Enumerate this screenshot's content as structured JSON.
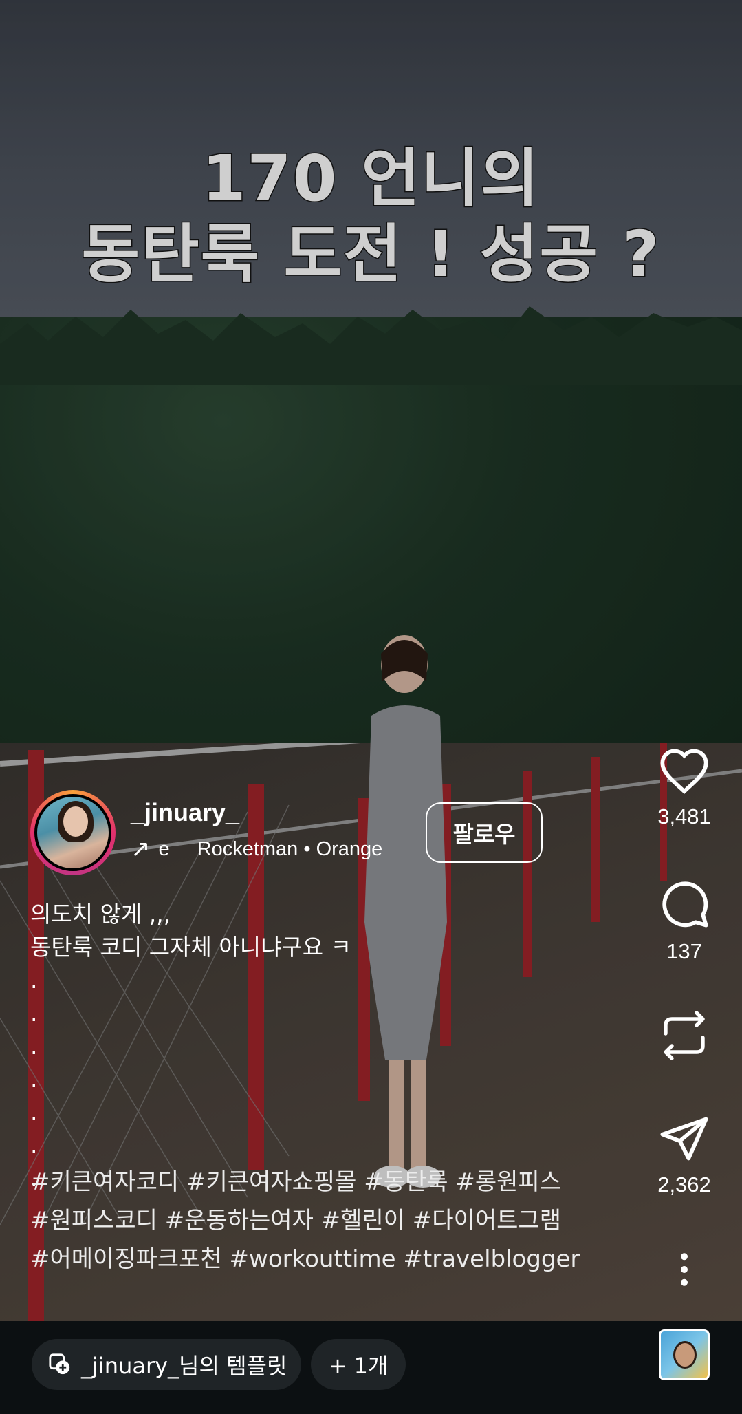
{
  "headline": {
    "line1": "170 언니의",
    "line2": "동탄룩 도전 ! 성공 ?"
  },
  "author": {
    "username": "_jinuary_",
    "music_prefix": "e",
    "music_track": "Rocketman • Orange",
    "follow_label": "팔로우"
  },
  "actions": {
    "likes": "3,481",
    "comments": "137",
    "shares": "2,362"
  },
  "caption": {
    "line1": "의도치 않게 ,,,",
    "line2": "동탄룩 코디 그자체 아니냐구요 ㅋ",
    "dots": [
      ".",
      ".",
      ".",
      ".",
      ".",
      ".",
      "."
    ]
  },
  "hashtags": {
    "line1": "#키큰여자코디 #키큰여자쇼핑몰 #동탄룩 #롱원피스",
    "line2": "#원피스코디 #운동하는여자 #헬린이 #다이어트그램",
    "line3": "#어메이징파크포천 #workouttime #travelblogger"
  },
  "bottom_bar": {
    "template_label": "_jinuary_님의 템플릿",
    "more_label": "+ 1개"
  },
  "icons": {
    "like": "heart-icon",
    "comment": "comment-icon",
    "repost": "repost-icon",
    "share": "send-icon",
    "more": "more-vertical-icon",
    "music": "arrow-up-right-icon",
    "template": "template-add-icon"
  }
}
